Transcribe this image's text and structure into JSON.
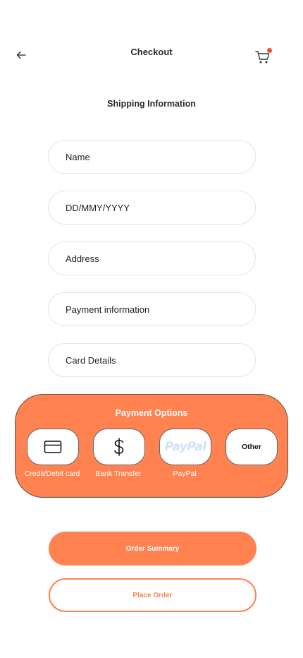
{
  "header": {
    "title": "Checkout"
  },
  "section_title": "Shipping Information",
  "form": {
    "name_placeholder": "Name",
    "dob_placeholder": "DD/MMY/YYYY",
    "address_placeholder": "Address",
    "payment_info_placeholder": "Payment information",
    "card_details_placeholder": "Card Details"
  },
  "payment_options": {
    "title": "Payment Options",
    "options": [
      {
        "label": "Credit/Debit card",
        "icon": "credit-card-icon"
      },
      {
        "label": "Bank Transfer",
        "icon": "dollar-icon"
      },
      {
        "label": "PayPal",
        "icon": "paypal-logo"
      },
      {
        "label": "Other",
        "icon": "none"
      }
    ],
    "paypal_logo_text": "PayPal"
  },
  "buttons": {
    "order_summary": "Order Summary",
    "place_order": "Place Order"
  },
  "colors": {
    "accent": "#ff8250",
    "notification_dot": "#e8543a"
  }
}
